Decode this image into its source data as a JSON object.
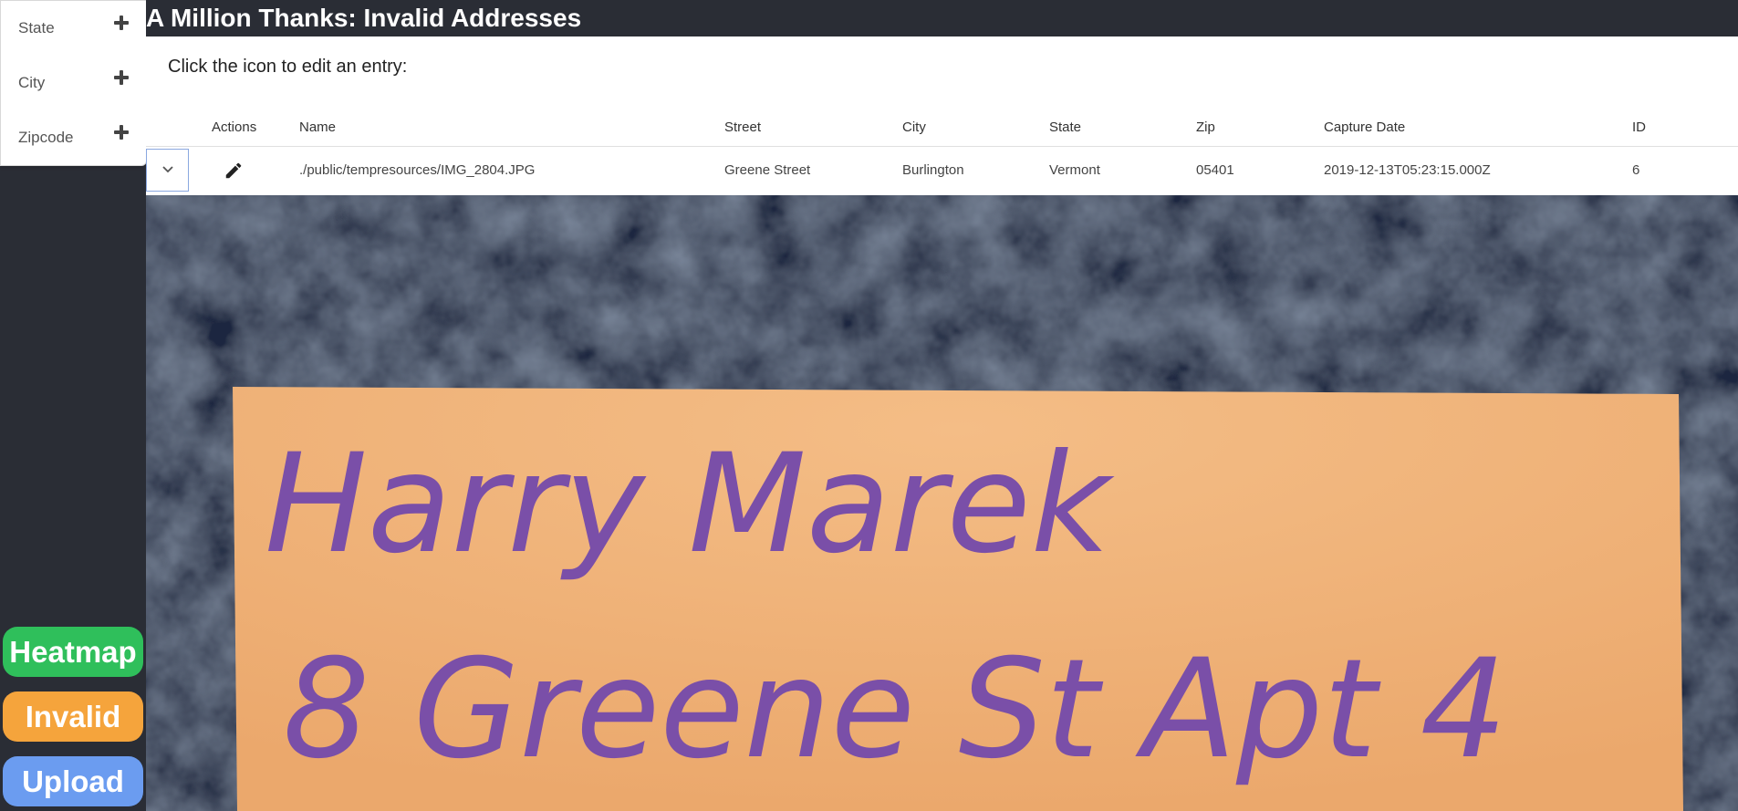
{
  "sidebar": {
    "filters": [
      {
        "label": "State"
      },
      {
        "label": "City"
      },
      {
        "label": "Zipcode"
      }
    ],
    "buttons": {
      "heatmap": "Heatmap",
      "invalid": "Invalid",
      "upload": "Upload"
    }
  },
  "header": {
    "title": "A Million Thanks: Invalid Addresses"
  },
  "main": {
    "instructions": "Click the icon to edit an entry:",
    "table": {
      "columns": [
        "Actions",
        "Name",
        "Street",
        "City",
        "State",
        "Zip",
        "Capture Date",
        "ID"
      ],
      "rows": [
        {
          "name": "./public/tempresources/IMG_2804.JPG",
          "street": "Greene Street",
          "city": "Burlington",
          "state": "Vermont",
          "zip": "05401",
          "capture_date": "2019-12-13T05:23:15.000Z",
          "id": "6"
        }
      ]
    },
    "photo": {
      "handwriting_line1": "Harry Marek",
      "handwriting_line2": "8 Greene St Apt 4"
    }
  },
  "colors": {
    "dark_bg": "#2a2d35",
    "heatmap_green": "#2fbf5b",
    "invalid_orange": "#f5a43c",
    "upload_blue": "#6b9cf0",
    "envelope": "#f0b177",
    "ink": "#7a4fa8"
  },
  "icons": {
    "filter_add": "plus-icon",
    "expand": "chevron-down-icon",
    "edit": "pencil-icon"
  }
}
